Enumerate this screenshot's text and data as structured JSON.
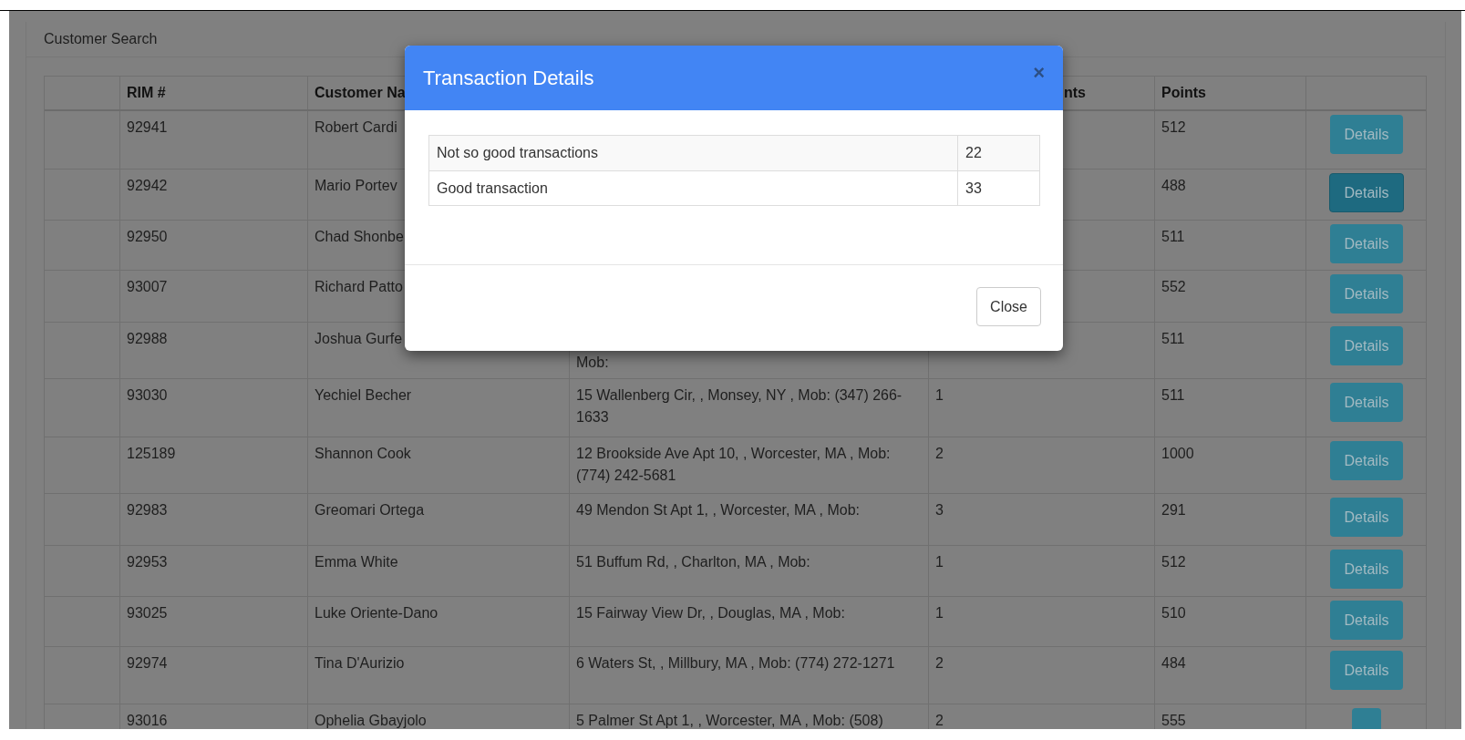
{
  "panel": {
    "title": "Customer Search"
  },
  "table": {
    "columns": [
      "",
      "RIM #",
      "Customer Na",
      "",
      "nts",
      "Points",
      ""
    ],
    "rows": [
      {
        "rim": "92941",
        "name": "Robert Cardi",
        "address": "",
        "count": "",
        "points": "512",
        "button": {
          "label": "Details",
          "selected": false
        }
      },
      {
        "rim": "92942",
        "name": "Mario Portev",
        "address": "",
        "count": "",
        "points": "488",
        "button": {
          "label": "Details",
          "selected": true
        }
      },
      {
        "rim": "92950",
        "name": "Chad Shonbe",
        "address": "",
        "count": "",
        "points": "511",
        "button": {
          "label": "Details",
          "selected": false
        }
      },
      {
        "rim": "93007",
        "name": "Richard Patto",
        "address": "",
        "count": "",
        "points": "552",
        "button": {
          "label": "Details",
          "selected": false
        }
      },
      {
        "rim": "92988",
        "name": "Joshua Gurfe",
        "address": "Mob:",
        "count": "",
        "points": "511",
        "button": {
          "label": "Details",
          "selected": false
        }
      },
      {
        "rim": "93030",
        "name": "Yechiel Becher",
        "address": "15 Wallenberg Cir, , Monsey, NY , Mob: (347) 266-1633",
        "count": "1",
        "points": "511",
        "button": {
          "label": "Details",
          "selected": false
        }
      },
      {
        "rim": "125189",
        "name": "Shannon Cook",
        "address": "12 Brookside Ave Apt 10, , Worcester, MA , Mob: (774) 242-5681",
        "count": "2",
        "points": "1000",
        "button": {
          "label": "Details",
          "selected": false
        }
      },
      {
        "rim": "92983",
        "name": "Greomari Ortega",
        "address": "49 Mendon St Apt 1, , Worcester, MA , Mob:",
        "count": "3",
        "points": "291",
        "button": {
          "label": "Details",
          "selected": false
        }
      },
      {
        "rim": "92953",
        "name": "Emma White",
        "address": "51 Buffum Rd, , Charlton, MA , Mob:",
        "count": "1",
        "points": "512",
        "button": {
          "label": "Details",
          "selected": false
        }
      },
      {
        "rim": "93025",
        "name": "Luke Oriente-Dano",
        "address": "15 Fairway View Dr, , Douglas, MA , Mob:",
        "count": "1",
        "points": "510",
        "button": {
          "label": "Details",
          "selected": false
        }
      },
      {
        "rim": "92974",
        "name": "Tina D'Aurizio",
        "address": "6 Waters St, , Millbury, MA , Mob: (774) 272-1271",
        "count": "2",
        "points": "484",
        "button": {
          "label": "Details",
          "selected": false
        }
      },
      {
        "rim": "93016",
        "name": "Ophelia Gbayjolo",
        "address": "5 Palmer St Apt 1, , Worcester, MA , Mob: (508)",
        "count": "2",
        "points": "555",
        "button": {
          "selected": false
        }
      }
    ]
  },
  "modal": {
    "title": "Transaction Details",
    "close_icon": "×",
    "rows": [
      {
        "label": "Not so good transactions",
        "value": "22"
      },
      {
        "label": "Good transaction",
        "value": "33"
      }
    ],
    "footer_button": "Close"
  }
}
